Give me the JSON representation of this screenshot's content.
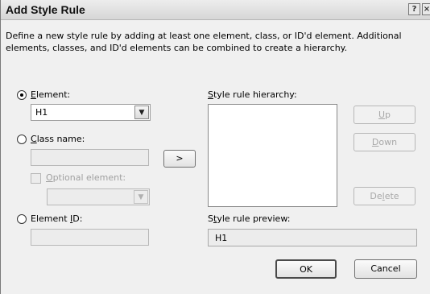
{
  "window": {
    "title": "Add Style Rule",
    "help_glyph": "?",
    "close_glyph": "×"
  },
  "description": "Define a new style rule by adding at least one element, class, or ID'd element.  Additional elements, classes, and ID'd elements can be combined to create a hierarchy.",
  "element": {
    "label": "Element:",
    "selected": true,
    "value": "H1"
  },
  "class_name": {
    "label": "Class name:",
    "selected": false,
    "value": ""
  },
  "optional_element": {
    "label": "Optional element:",
    "checked": false,
    "value": ""
  },
  "element_id": {
    "label": "Element ID:",
    "selected": false,
    "value": ""
  },
  "add_button": ">",
  "hierarchy": {
    "label": "Style rule hierarchy:",
    "items": []
  },
  "buttons": {
    "up": "Up",
    "down": "Down",
    "delete": "Delete",
    "ok": "OK",
    "cancel": "Cancel"
  },
  "preview": {
    "label": "Style rule preview:",
    "value": "H1"
  },
  "icons": {
    "dropdown": "chevron-down-icon",
    "help": "help-icon",
    "close": "close-icon"
  }
}
